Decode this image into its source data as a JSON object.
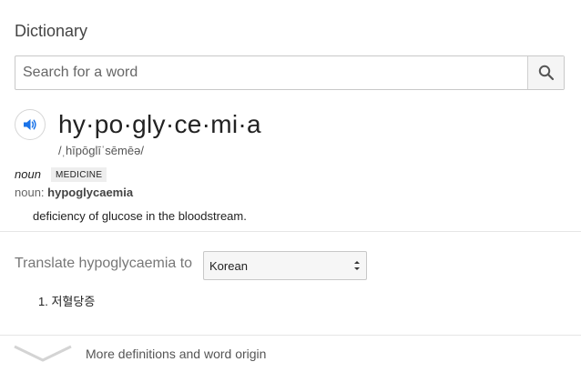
{
  "header": {
    "title": "Dictionary"
  },
  "search": {
    "placeholder": "Search for a word",
    "value": ""
  },
  "entry": {
    "word": "hy·po·gly·ce·mi·a",
    "phonetic": "/ˌhīpōglīˈsēmēə/",
    "part_of_speech": "noun",
    "subject_tag": "MEDICINE",
    "variant_prefix": "noun: ",
    "variant_word": "hypoglycaemia",
    "definition": "deficiency of glucose in the bloodstream."
  },
  "translate": {
    "label": "Translate hypoglycaemia to",
    "selected_language": "Korean",
    "results": [
      {
        "number": "1.",
        "text": "저혈당증"
      }
    ]
  },
  "footer": {
    "more_label": "More definitions and word origin"
  },
  "icons": {
    "search": "search-icon",
    "speaker": "speaker-icon",
    "more": "chevron-down-icon",
    "select": "select-arrows-icon"
  },
  "colors": {
    "speaker_accent": "#1a73e8"
  }
}
